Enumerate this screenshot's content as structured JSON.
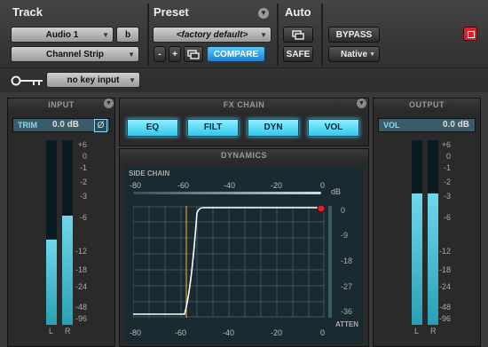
{
  "header": {
    "track_title": "Track",
    "preset_title": "Preset",
    "auto_title": "Auto",
    "track_name": "Audio 1",
    "track_suffix": "b",
    "insert_name": "Channel Strip",
    "preset_name": "<factory default>",
    "minus": "-",
    "plus": "+",
    "compare": "COMPARE",
    "bypass": "BYPASS",
    "safe": "SAFE",
    "native": "Native",
    "key_input": "no key input"
  },
  "input": {
    "title": "INPUT",
    "trim_label": "TRIM",
    "trim_value": "0.0 dB",
    "phase": "Ø",
    "scale": [
      "+6",
      "0",
      "-1",
      "-2",
      "-3",
      "-6",
      "-12",
      "-18",
      "-24",
      "-48",
      "-96"
    ],
    "left_label": "L",
    "right_label": "R",
    "level_left": 0.46,
    "level_right": 0.59
  },
  "fx_chain": {
    "title": "FX CHAIN",
    "buttons": [
      "EQ",
      "FILT",
      "DYN",
      "VOL"
    ]
  },
  "dynamics": {
    "title": "DYNAMICS",
    "side_chain_label": "SIDE CHAIN",
    "sc_scale": [
      "-80",
      "-60",
      "-40",
      "-20",
      "0"
    ],
    "db_label": "dB",
    "x_scale": [
      "-80",
      "-60",
      "-40",
      "-20",
      "0"
    ],
    "right_scale": [
      "0",
      "-9",
      "-18",
      "-27",
      "-36"
    ],
    "atten_label": "ATTEN"
  },
  "output": {
    "title": "OUTPUT",
    "vol_label": "VOL",
    "vol_value": "0.0 dB",
    "scale": [
      "+6",
      "0",
      "-1",
      "-2",
      "-3",
      "-6",
      "-12",
      "-18",
      "-24",
      "-48",
      "-96"
    ],
    "left_label": "L",
    "right_label": "R",
    "level_left": 0.71,
    "level_right": 0.71
  },
  "colors": {
    "accent": "#35c6ee",
    "meter": "#4fc3d9",
    "record": "#e0202a"
  }
}
